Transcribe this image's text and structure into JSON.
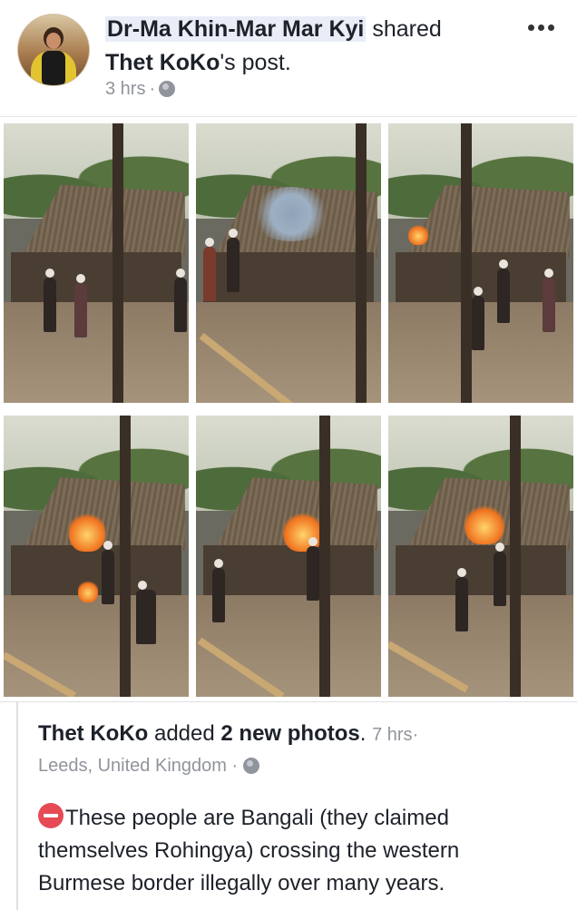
{
  "post_header": {
    "author": "Dr-Ma Khin-Mar Mar Kyi",
    "shared_word": "shared",
    "original_author": "Thet KoKo",
    "post_suffix": "'s post.",
    "time": "3 hrs",
    "separator": "·"
  },
  "icons": {
    "more": "more-options-icon",
    "privacy": "globe-icon",
    "warning": "no-entry-icon"
  },
  "shared_post": {
    "author": "Thet KoKo",
    "action_prefix": "added",
    "photo_count_text": "2 new photos",
    "time": "7 hrs",
    "separator": "·",
    "location": "Leeds, United Kingdom",
    "text": "These people are Bangali (they claimed themselves Rohingya) crossing the western Burmese border illegally over many years."
  },
  "colors": {
    "text": "#1d2129",
    "meta": "#90949c",
    "name_highlight": "#e8edf7",
    "warning_red": "#e64b55"
  }
}
